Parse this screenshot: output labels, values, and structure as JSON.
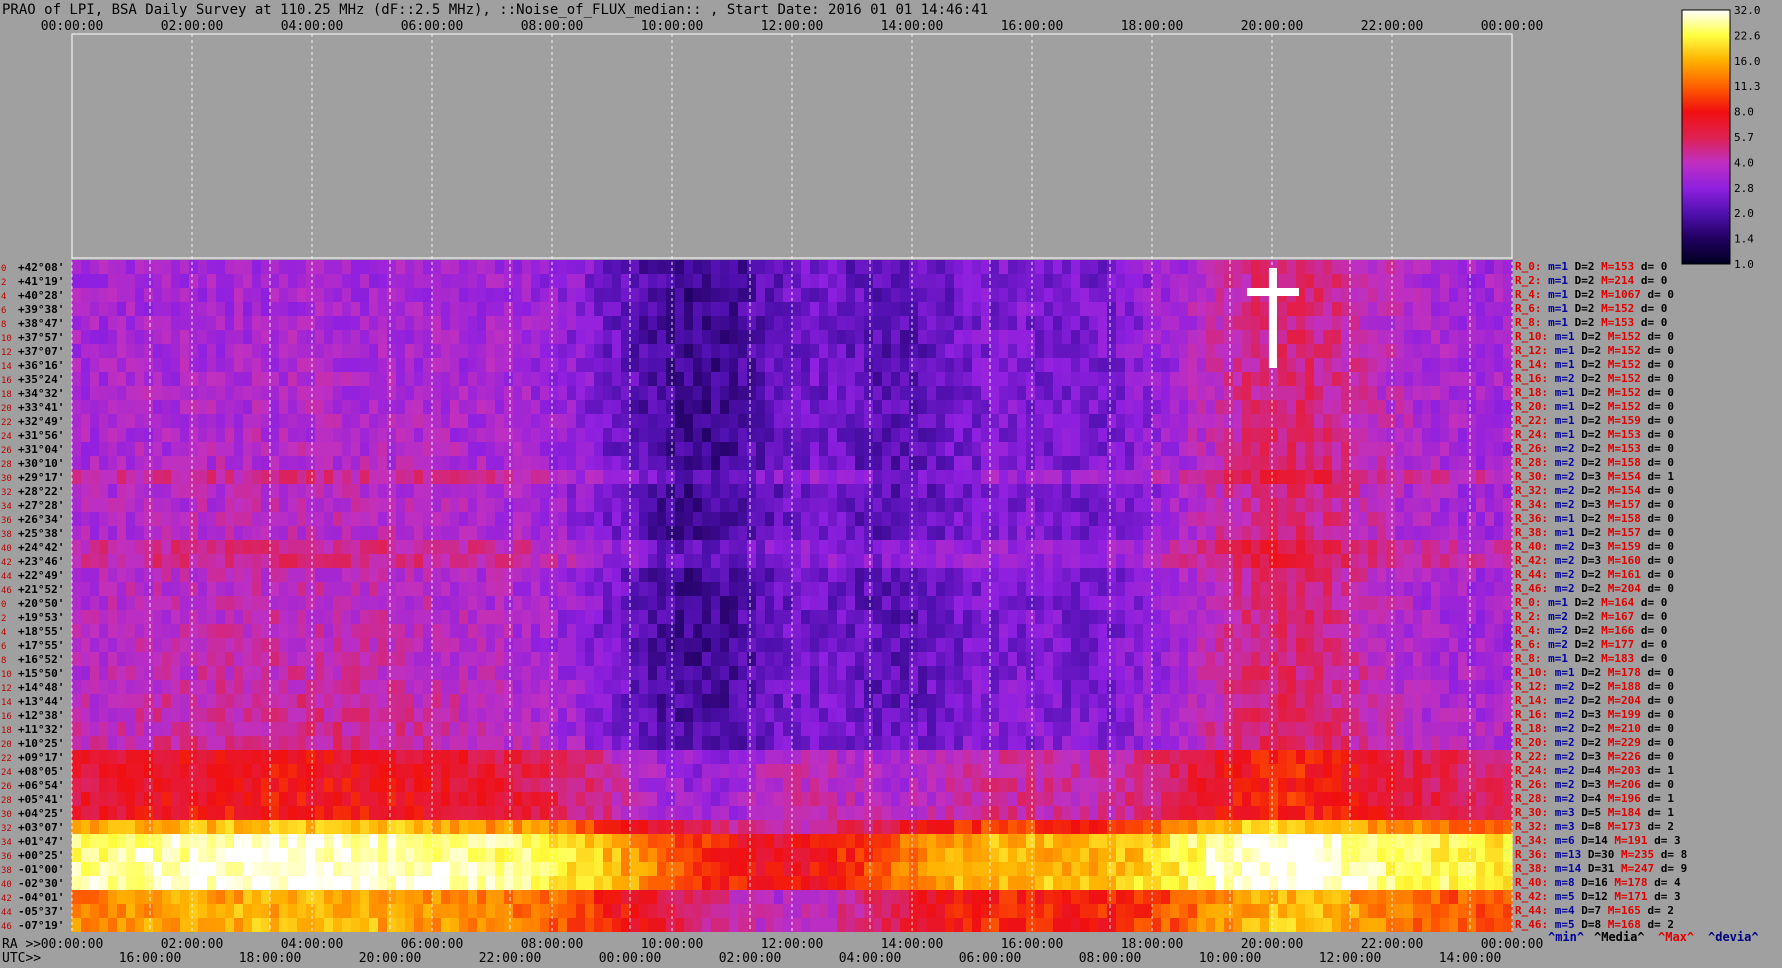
{
  "header": {
    "title": "PRAO of LPI, BSA Daily Survey at 110.25 MHz (dF::2.5 MHz), ::Noise_of_FLUX_median:: , Start Date: 2016 01 01 14:46:41"
  },
  "footer": {
    "ra_label": "RA >>",
    "utc_label": "UTC>>",
    "legend": [
      {
        "text": "^min^",
        "color": "#0000a0"
      },
      {
        "text": "^Media^",
        "color": "#000000"
      },
      {
        "text": "^Max^",
        "color": "#e00000"
      },
      {
        "text": "^devia^",
        "color": "#000080"
      }
    ]
  },
  "chart_data": {
    "type": "heatmap",
    "title": "PRAO of LPI, BSA Daily Survey at 110.25 MHz (dF::2.5 MHz), ::Noise_of_FLUX_median:: , Start Date: 2016 01 01 14:46:41",
    "x_top_ticks": [
      "00:00:00",
      "02:00:00",
      "04:00:00",
      "06:00:00",
      "08:00:00",
      "10:00:00",
      "12:00:00",
      "14:00:00",
      "16:00:00",
      "18:00:00",
      "20:00:00",
      "22:00:00",
      "00:00:00"
    ],
    "x_ra_ticks": [
      "00:00:00",
      "02:00:00",
      "04:00:00",
      "06:00:00",
      "08:00:00",
      "10:00:00",
      "12:00:00",
      "14:00:00",
      "16:00:00",
      "18:00:00",
      "20:00:00",
      "22:00:00",
      "00:00:00"
    ],
    "x_utc_ticks": [
      "16:00:00",
      "18:00:00",
      "20:00:00",
      "22:00:00",
      "00:00:00",
      "02:00:00",
      "04:00:00",
      "06:00:00",
      "08:00:00",
      "10:00:00",
      "12:00:00",
      "14:00:00"
    ],
    "row_numbers": [
      "0",
      "2",
      "4",
      "6",
      "8",
      "10",
      "12",
      "14",
      "16",
      "18",
      "20",
      "22",
      "24",
      "26",
      "28",
      "30",
      "32",
      "34",
      "36",
      "38",
      "40",
      "42",
      "44",
      "46",
      "0",
      "2",
      "4",
      "6",
      "8",
      "10",
      "12",
      "14",
      "16",
      "18",
      "20",
      "22",
      "24",
      "26",
      "28",
      "30",
      "32",
      "34",
      "36",
      "38",
      "40",
      "42",
      "44",
      "46"
    ],
    "declinations": [
      "+42°08'",
      "+41°19'",
      "+40°28'",
      "+39°38'",
      "+38°47'",
      "+37°57'",
      "+37°07'",
      "+36°16'",
      "+35°24'",
      "+34°32'",
      "+33°41'",
      "+32°49'",
      "+31°56'",
      "+31°04'",
      "+30°10'",
      "+29°17'",
      "+28°22'",
      "+27°28'",
      "+26°34'",
      "+25°38'",
      "+24°42'",
      "+23°46'",
      "+22°49'",
      "+21°52'",
      "+20°50'",
      "+19°53'",
      "+18°55'",
      "+17°55'",
      "+16°52'",
      "+15°50'",
      "+14°48'",
      "+13°44'",
      "+12°38'",
      "+11°32'",
      "+10°25'",
      "+09°17'",
      "+08°05'",
      "+06°54'",
      "+05°41'",
      "+04°25'",
      "+03°07'",
      "+01°47'",
      "+00°25'",
      "-01°00'",
      "-02°30'",
      "-04°01'",
      "-05°37'",
      "-07°19'"
    ],
    "row_stats": [
      {
        "label": "R_0:",
        "m": "m=1",
        "D": "D=2",
        "M": "M=153",
        "d": "d= 0"
      },
      {
        "label": "R_2:",
        "m": "m=1",
        "D": "D=2",
        "M": "M=214",
        "d": "d= 0"
      },
      {
        "label": "R_4:",
        "m": "m=1",
        "D": "D=2",
        "M": "M=1067",
        "d": "d= 0"
      },
      {
        "label": "R_6:",
        "m": "m=1",
        "D": "D=2",
        "M": "M=152",
        "d": "d= 0"
      },
      {
        "label": "R_8:",
        "m": "m=1",
        "D": "D=2",
        "M": "M=153",
        "d": "d= 0"
      },
      {
        "label": "R_10:",
        "m": "m=1",
        "D": "D=2",
        "M": "M=152",
        "d": "d= 0"
      },
      {
        "label": "R_12:",
        "m": "m=1",
        "D": "D=2",
        "M": "M=152",
        "d": "d= 0"
      },
      {
        "label": "R_14:",
        "m": "m=1",
        "D": "D=2",
        "M": "M=152",
        "d": "d= 0"
      },
      {
        "label": "R_16:",
        "m": "m=2",
        "D": "D=2",
        "M": "M=152",
        "d": "d= 0"
      },
      {
        "label": "R_18:",
        "m": "m=1",
        "D": "D=2",
        "M": "M=152",
        "d": "d= 0"
      },
      {
        "label": "R_20:",
        "m": "m=1",
        "D": "D=2",
        "M": "M=152",
        "d": "d= 0"
      },
      {
        "label": "R_22:",
        "m": "m=1",
        "D": "D=2",
        "M": "M=159",
        "d": "d= 0"
      },
      {
        "label": "R_24:",
        "m": "m=1",
        "D": "D=2",
        "M": "M=153",
        "d": "d= 0"
      },
      {
        "label": "R_26:",
        "m": "m=2",
        "D": "D=2",
        "M": "M=153",
        "d": "d= 0"
      },
      {
        "label": "R_28:",
        "m": "m=2",
        "D": "D=2",
        "M": "M=158",
        "d": "d= 0"
      },
      {
        "label": "R_30:",
        "m": "m=2",
        "D": "D=3",
        "M": "M=154",
        "d": "d= 1"
      },
      {
        "label": "R_32:",
        "m": "m=2",
        "D": "D=2",
        "M": "M=154",
        "d": "d= 0"
      },
      {
        "label": "R_34:",
        "m": "m=2",
        "D": "D=3",
        "M": "M=157",
        "d": "d= 0"
      },
      {
        "label": "R_36:",
        "m": "m=1",
        "D": "D=2",
        "M": "M=158",
        "d": "d= 0"
      },
      {
        "label": "R_38:",
        "m": "m=1",
        "D": "D=2",
        "M": "M=157",
        "d": "d= 0"
      },
      {
        "label": "R_40:",
        "m": "m=2",
        "D": "D=3",
        "M": "M=159",
        "d": "d= 0"
      },
      {
        "label": "R_42:",
        "m": "m=2",
        "D": "D=3",
        "M": "M=160",
        "d": "d= 0"
      },
      {
        "label": "R_44:",
        "m": "m=2",
        "D": "D=2",
        "M": "M=161",
        "d": "d= 0"
      },
      {
        "label": "R_46:",
        "m": "m=2",
        "D": "D=2",
        "M": "M=204",
        "d": "d= 0"
      },
      {
        "label": "R_0:",
        "m": "m=1",
        "D": "D=2",
        "M": "M=164",
        "d": "d= 0"
      },
      {
        "label": "R_2:",
        "m": "m=2",
        "D": "D=2",
        "M": "M=167",
        "d": "d= 0"
      },
      {
        "label": "R_4:",
        "m": "m=2",
        "D": "D=2",
        "M": "M=166",
        "d": "d= 0"
      },
      {
        "label": "R_6:",
        "m": "m=2",
        "D": "D=2",
        "M": "M=177",
        "d": "d= 0"
      },
      {
        "label": "R_8:",
        "m": "m=1",
        "D": "D=2",
        "M": "M=183",
        "d": "d= 0"
      },
      {
        "label": "R_10:",
        "m": "m=1",
        "D": "D=2",
        "M": "M=178",
        "d": "d= 0"
      },
      {
        "label": "R_12:",
        "m": "m=2",
        "D": "D=2",
        "M": "M=188",
        "d": "d= 0"
      },
      {
        "label": "R_14:",
        "m": "m=2",
        "D": "D=2",
        "M": "M=204",
        "d": "d= 0"
      },
      {
        "label": "R_16:",
        "m": "m=2",
        "D": "D=3",
        "M": "M=199",
        "d": "d= 0"
      },
      {
        "label": "R_18:",
        "m": "m=2",
        "D": "D=2",
        "M": "M=210",
        "d": "d= 0"
      },
      {
        "label": "R_20:",
        "m": "m=2",
        "D": "D=2",
        "M": "M=229",
        "d": "d= 0"
      },
      {
        "label": "R_22:",
        "m": "m=2",
        "D": "D=3",
        "M": "M=226",
        "d": "d= 0"
      },
      {
        "label": "R_24:",
        "m": "m=2",
        "D": "D=4",
        "M": "M=203",
        "d": "d= 1"
      },
      {
        "label": "R_26:",
        "m": "m=2",
        "D": "D=3",
        "M": "M=206",
        "d": "d= 0"
      },
      {
        "label": "R_28:",
        "m": "m=2",
        "D": "D=4",
        "M": "M=196",
        "d": "d= 1"
      },
      {
        "label": "R_30:",
        "m": "m=3",
        "D": "D=5",
        "M": "M=184",
        "d": "d= 1"
      },
      {
        "label": "R_32:",
        "m": "m=3",
        "D": "D=8",
        "M": "M=173",
        "d": "d= 2"
      },
      {
        "label": "R_34:",
        "m": "m=6",
        "D": "D=14",
        "M": "M=191",
        "d": "d= 3"
      },
      {
        "label": "R_36:",
        "m": "m=13",
        "D": "D=30",
        "M": "M=235",
        "d": "d= 8"
      },
      {
        "label": "R_38:",
        "m": "m=14",
        "D": "D=31",
        "M": "M=247",
        "d": "d= 9"
      },
      {
        "label": "R_40:",
        "m": "m=8",
        "D": "D=16",
        "M": "M=178",
        "d": "d= 4"
      },
      {
        "label": "R_42:",
        "m": "m=5",
        "D": "D=12",
        "M": "M=171",
        "d": "d= 3"
      },
      {
        "label": "R_44:",
        "m": "m=4",
        "D": "D=7",
        "M": "M=165",
        "d": "d= 2"
      },
      {
        "label": "R_46:",
        "m": "m=5",
        "D": "D=8",
        "M": "M=168",
        "d": "d= 2"
      }
    ],
    "colorbar_ticks": [
      "32.0",
      "22.6",
      "16.0",
      "11.3",
      "8.0",
      "5.7",
      "4.0",
      "2.8",
      "2.0",
      "1.4",
      "1.0"
    ],
    "colormap": [
      "#000020",
      "#200060",
      "#5010b0",
      "#9020e0",
      "#c030c0",
      "#e02050",
      "#f01010",
      "#ff6000",
      "#ffb000",
      "#ffff40",
      "#ffffff"
    ],
    "stat_colors": {
      "label": "#e00000",
      "m": "#0000a0",
      "D": "#000000",
      "M": "#e00000",
      "d": "#000000"
    }
  }
}
